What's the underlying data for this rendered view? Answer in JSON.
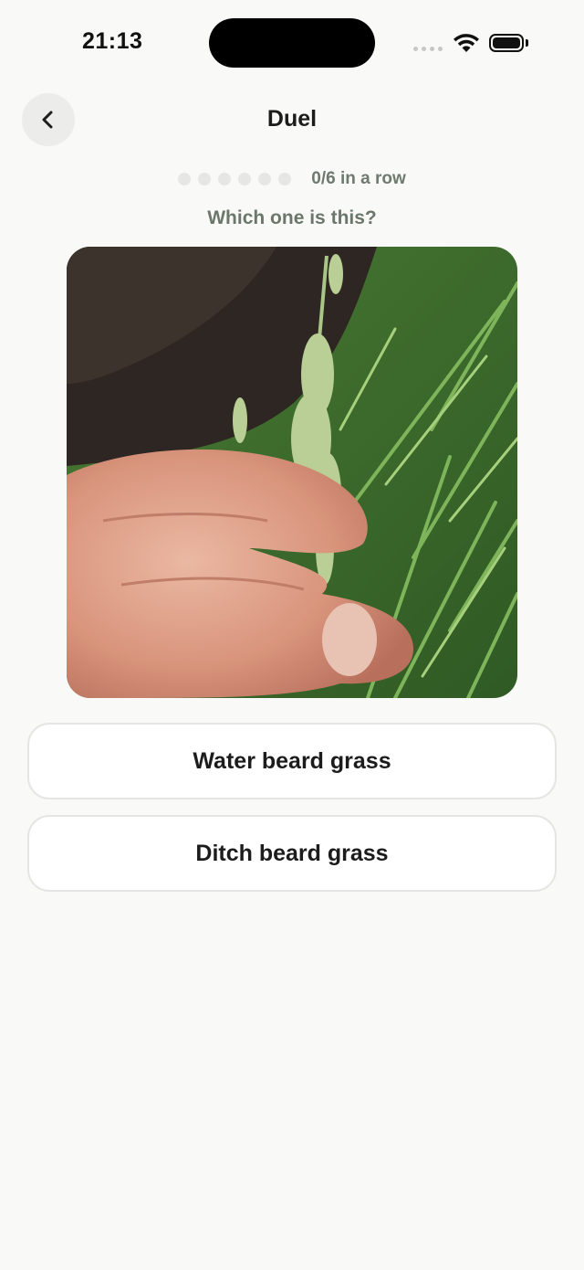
{
  "status_bar": {
    "time": "21:13"
  },
  "header": {
    "title": "Duel",
    "back_icon": "chevron-left-icon"
  },
  "progress": {
    "streak_text": "0/6 in a row",
    "current": 0,
    "total": 6
  },
  "question": "Which one is this?",
  "photo": {
    "subject": "grass seed head held between fingers"
  },
  "answers": [
    {
      "label": "Water beard grass"
    },
    {
      "label": "Ditch beard grass"
    }
  ],
  "colors": {
    "background": "#f9f9f7",
    "accent_text": "#6b776b",
    "button_border": "#e5e5e3"
  }
}
